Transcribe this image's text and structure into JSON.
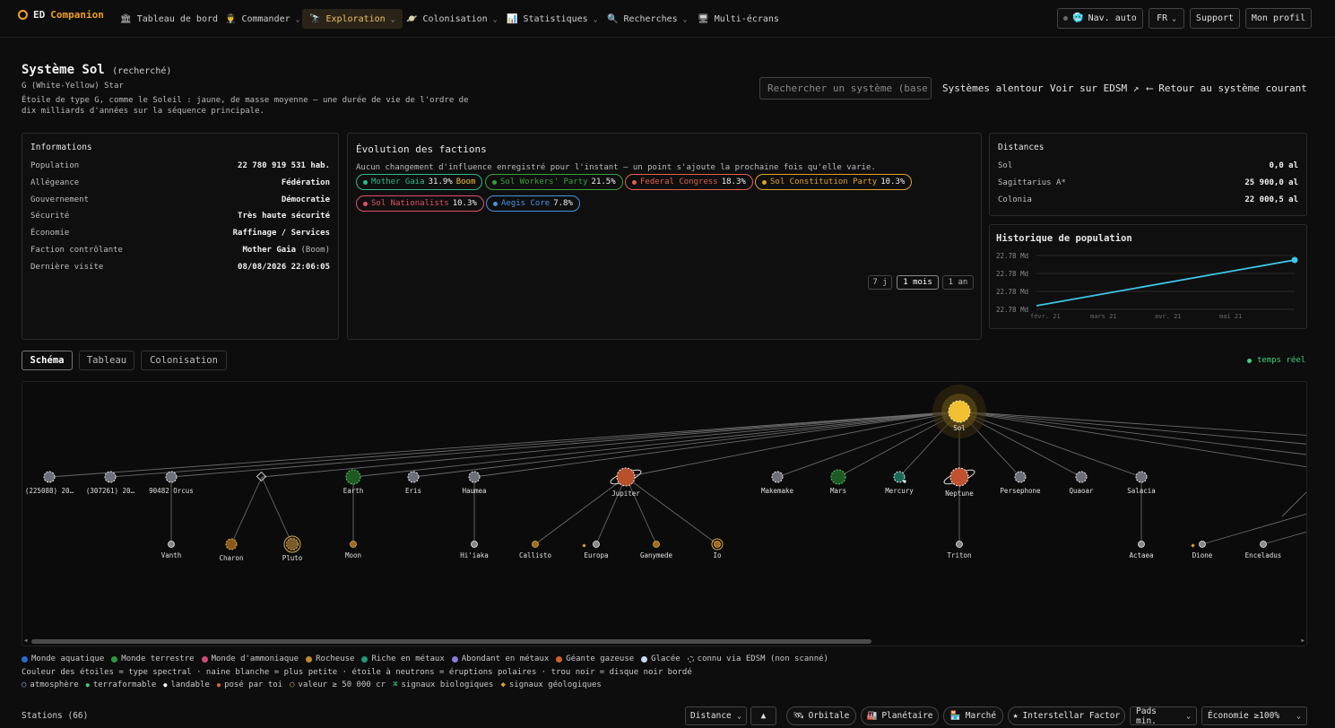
{
  "app": {
    "brand_a": "ED",
    "brand_b": "Companion"
  },
  "nav": {
    "items": [
      {
        "icon": "🏛",
        "label": "Tableau de bord",
        "chev": ""
      },
      {
        "icon": "👨‍✈️",
        "label": "Commander",
        "chev": "⌄"
      },
      {
        "icon": "🔭",
        "label": "Exploration",
        "chev": "⌄"
      },
      {
        "icon": "🪐",
        "label": "Colonisation",
        "chev": "⌄"
      },
      {
        "icon": "📊",
        "label": "Statistiques",
        "chev": "⌄"
      },
      {
        "icon": "🔍",
        "label": "Recherches",
        "chev": "⌄"
      },
      {
        "icon": "🖥",
        "label": "Multi-écrans",
        "chev": ""
      }
    ],
    "navauto": "Nav. auto",
    "lang": "FR",
    "support": "Support",
    "profile": "Mon profil"
  },
  "system": {
    "name": "Système Sol",
    "qualifier": "(recherché)",
    "star_type": "G (White-Yellow) Star",
    "star_desc": "Étoile de type G, comme le Soleil : jaune, de masse moyenne — une durée de vie de l'ordre de dix milliards d'années sur la séquence principale.",
    "search_placeholder": "Rechercher un système (base",
    "link_nearby": "Systèmes alentour",
    "link_edsm": "Voir sur EDSM ↗",
    "link_back": "⟵ Retour au système courant"
  },
  "info": {
    "title": "Informations",
    "rows": [
      {
        "k": "Population",
        "v": "22 780 919 531 hab.",
        "n": ""
      },
      {
        "k": "Allégeance",
        "v": "Fédération",
        "n": ""
      },
      {
        "k": "Gouvernement",
        "v": "Démocratie",
        "n": ""
      },
      {
        "k": "Sécurité",
        "v": "Très haute sécurité",
        "n": ""
      },
      {
        "k": "Économie",
        "v": "Raffinage / Services",
        "n": ""
      },
      {
        "k": "Faction contrôlante",
        "v": "Mother Gaia",
        "n": " (Boom)"
      },
      {
        "k": "Dernière visite",
        "v": "08/08/2026 22:06:05",
        "n": ""
      }
    ]
  },
  "factions": {
    "title": "Évolution des factions",
    "ranges": [
      "7 j",
      "1 mois",
      "1 an"
    ],
    "note": "Aucun changement d'influence enregistré pour l'instant — un point s'ajoute la prochaine fois qu'elle varie.",
    "pills": [
      {
        "name": "Mother Gaia",
        "pct": "31.9%",
        "state": "Boom",
        "color": "#2fb88a"
      },
      {
        "name": "Sol Workers' Party",
        "pct": "21.5%",
        "state": "",
        "color": "#3aa040"
      },
      {
        "name": "Federal Congress",
        "pct": "18.3%",
        "state": "",
        "color": "#e0604a"
      },
      {
        "name": "Sol Constitution Party",
        "pct": "10.3%",
        "state": "",
        "color": "#e0a030"
      },
      {
        "name": "Sol Nationalists",
        "pct": "10.3%",
        "state": "",
        "color": "#e0506a"
      },
      {
        "name": "Aegis Core",
        "pct": "7.8%",
        "state": "",
        "color": "#4a90e0"
      }
    ]
  },
  "distances": {
    "title": "Distances",
    "rows": [
      {
        "k": "Sol",
        "v": "0,0 al"
      },
      {
        "k": "Sagittarius A*",
        "v": "25 900,0 al"
      },
      {
        "k": "Colonia",
        "v": "22 000,5 al"
      }
    ]
  },
  "pophistory": {
    "title": "Historique de population"
  },
  "chart_data": {
    "type": "line",
    "title": "Historique de population",
    "x": [
      "févr. 21",
      "mars 21",
      "avr. 21",
      "mai 21"
    ],
    "y_tick_labels": [
      "22.78 Md",
      "22.78 Md",
      "22.78 Md",
      "22.78 Md"
    ],
    "series": [
      {
        "values": [
          22780919531,
          22780919531
        ]
      }
    ],
    "color": "#3ec6e8",
    "grid": true
  },
  "tabs": [
    "Schéma",
    "Tableau",
    "Colonisation"
  ],
  "live": "temps réel",
  "bodies": {
    "sol": "Sol",
    "top": [
      "(225088) 20…",
      "(307261) 20…",
      "90482 Orcus",
      "",
      "Earth",
      "Eris",
      "Haumea",
      "Jupiter",
      "Makemake",
      "Mars",
      "Mercury",
      "Neptune",
      "Persephone",
      "Quaoar",
      "Salacia"
    ],
    "moons": [
      "Vanth",
      "Charon",
      "Pluto",
      "Moon",
      "Hi'iaka",
      "Callisto",
      "Europa",
      "Ganymede",
      "Io",
      "Triton",
      "Actaea",
      "Dione",
      "Enceladus"
    ]
  },
  "legend1": [
    {
      "label": "Monde aquatique",
      "color": "#2a6ad0"
    },
    {
      "label": "Monde terrestre",
      "color": "#2a9a3a"
    },
    {
      "label": "Monde d'ammoniaque",
      "color": "#d04a7a"
    },
    {
      "label": "Rocheuse",
      "color": "#c08a30"
    },
    {
      "label": "Riche en métaux",
      "color": "#1f9a7a"
    },
    {
      "label": "Abondant en métaux",
      "color": "#8a7ad8"
    },
    {
      "label": "Géante gazeuse",
      "color": "#d0602a"
    },
    {
      "label": "Glacée",
      "color": "#c8d8f0"
    },
    {
      "label": "connu via EDSM (non scanné)",
      "color": "none"
    }
  ],
  "legend2": "Couleur des étoiles = type spectral · naine blanche = plus petite · étoile à neutrons = éruptions polaires · trou noir = disque noir bordé",
  "legend3": [
    {
      "sym": "○",
      "label": "atmosphère"
    },
    {
      "sym": "●",
      "label": "terraformable"
    },
    {
      "sym": "●",
      "label": "landable"
    },
    {
      "sym": "●",
      "label": "posé par toi"
    },
    {
      "sym": "○",
      "label": "valeur ≥ 50 000 cr"
    },
    {
      "sym": "⌘",
      "label": "signaux biologiques"
    },
    {
      "sym": "◆",
      "label": "signaux géologiques"
    }
  ],
  "bottom": {
    "stations": "Stations (66)",
    "sort": "Distance",
    "sort_dir": "▲",
    "f_orbital": "Orbitale",
    "f_planetary": "Planétaire",
    "f_market": "Marché",
    "f_interstellar": "Interstellar Factor",
    "pads": "Pads min.",
    "economy": "Économie ≥100%"
  }
}
